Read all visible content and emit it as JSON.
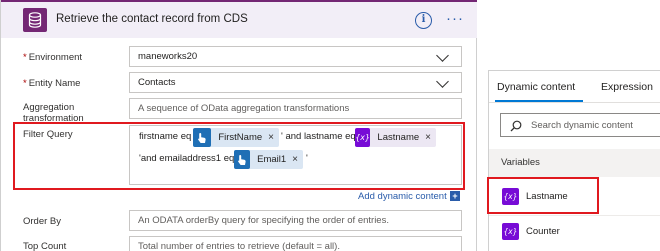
{
  "card": {
    "title": "Retrieve the contact record from CDS",
    "more": "···",
    "info": "i"
  },
  "fields": {
    "environment_label": "Environment",
    "environment_value": "maneworks20",
    "entity_label": "Entity Name",
    "entity_value": "Contacts",
    "aggregation_label_1": "Aggregation",
    "aggregation_label_2": "transformation",
    "aggregation_placeholder": "A sequence of OData aggregation transformations",
    "filter_label": "Filter Query",
    "order_label": "Order By",
    "order_placeholder": "An ODATA orderBy query for specifying the order of entries.",
    "top_label": "Top Count",
    "top_placeholder": "Total number of entries to retrieve (default = all)."
  },
  "filter": {
    "text1": "firstname eq '",
    "token1": "FirstName",
    "text2": "' and lastname eq '",
    "token2": "Lastname",
    "text3": "'and emailaddress1 eq '",
    "token3": "Email1",
    "text4": "'",
    "remove": "×",
    "expr_icon": "{x}"
  },
  "add_dynamic": {
    "label": "Add dynamic content",
    "plus": "+"
  },
  "pane": {
    "tab_dynamic": "Dynamic content",
    "tab_expression": "Expression",
    "search_placeholder": "Search dynamic content",
    "section": "Variables",
    "items": [
      {
        "label": "Lastname",
        "icon": "{x}"
      },
      {
        "label": "Counter",
        "icon": "{x}"
      }
    ]
  },
  "colors": {
    "cds_purple": "#742774",
    "variable_purple": "#770bd6",
    "dynamic_blue": "#1f6fb5",
    "link_blue": "#2a5caa",
    "highlight_red": "#e0191f"
  }
}
